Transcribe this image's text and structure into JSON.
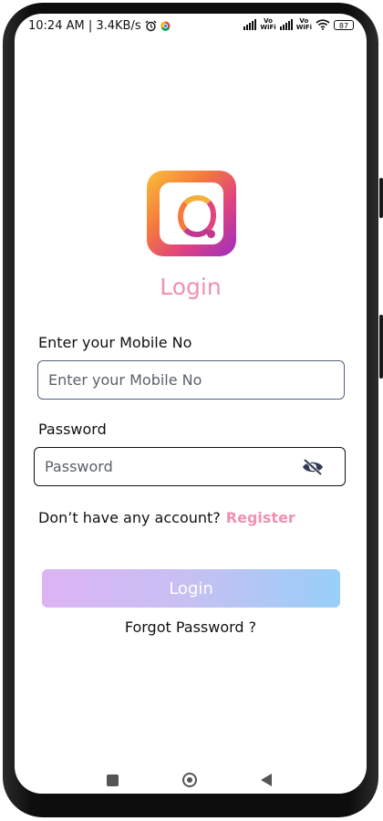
{
  "status_bar": {
    "time_speed": "10:24 AM | 3.4KB/s",
    "wifi_label_1": "Vo\nWiFi",
    "wifi_label_2": "Vo\nWiFi",
    "battery": "87"
  },
  "icons": {
    "alarm": "alarm-icon",
    "chrome": "chrome-icon",
    "eye_off": "eye-off-icon"
  },
  "colors": {
    "accent_pink": "#f191b0",
    "button_gradient_start": "#dcb3f3",
    "button_gradient_end": "#98cff8"
  },
  "page": {
    "title": "Login",
    "mobile_label": "Enter your Mobile No",
    "mobile_placeholder": "Enter your Mobile No",
    "password_label": "Password",
    "password_placeholder": "Password",
    "no_account_text": "Don’t have any account?",
    "register_link": "Register",
    "login_button": "Login",
    "forgot_password": "Forgot Password ?"
  }
}
